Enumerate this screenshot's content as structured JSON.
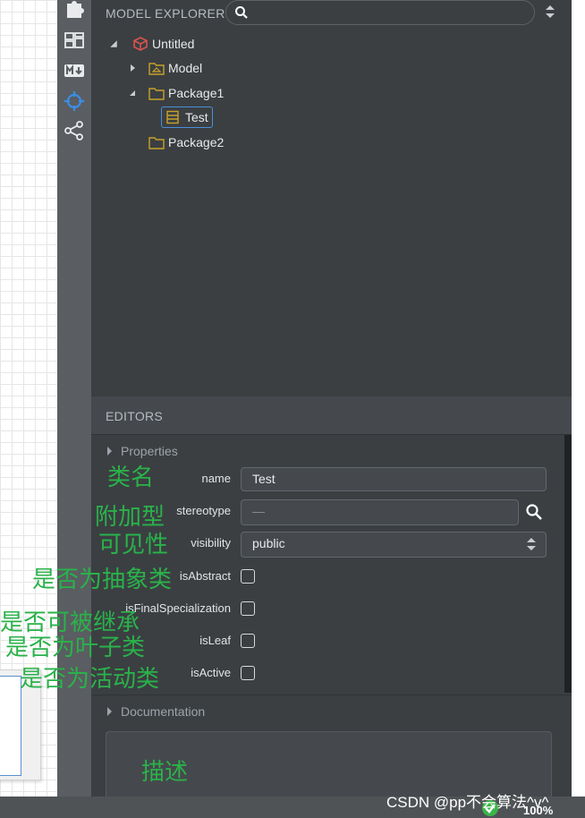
{
  "model_explorer": {
    "title": "MODEL EXPLORER",
    "search_placeholder": ""
  },
  "tree": [
    {
      "label": "Untitled",
      "type": "project",
      "expanded": true,
      "level": 0
    },
    {
      "label": "Model",
      "type": "model",
      "expanded": false,
      "level": 1
    },
    {
      "label": "Package1",
      "type": "package",
      "expanded": true,
      "level": 1
    },
    {
      "label": "Test",
      "type": "class",
      "selected": true,
      "level": 2
    },
    {
      "label": "Package2",
      "type": "package",
      "level": 1
    }
  ],
  "editors": {
    "title": "EDITORS",
    "properties_label": "Properties",
    "documentation_label": "Documentation",
    "fields": {
      "name_label": "name",
      "name_value": "Test",
      "stereotype_label": "stereotype",
      "stereotype_placeholder": "—",
      "visibility_label": "visibility",
      "visibility_value": "public",
      "isAbstract_label": "isAbstract",
      "isAbstract_checked": false,
      "isFinalSpecialization_label": "isFinalSpecialization",
      "isFinalSpecialization_checked": false,
      "isLeaf_label": "isLeaf",
      "isLeaf_checked": false,
      "isActive_label": "isActive",
      "isActive_checked": false
    }
  },
  "annotations": {
    "class_name": "类名",
    "stereotype": "附加型",
    "visibility": "可见性",
    "abstract": "是否为抽象类",
    "final": "是否可被继承",
    "leaf": "是否为叶子类",
    "active": "是否为活动类",
    "description": "描述"
  },
  "status": {
    "zoom": "100%",
    "watermark": "CSDN @pp不会算法^v^"
  },
  "colors": {
    "panel_bg": "#3b3f42",
    "accent_blue": "#4a90d9",
    "annotation_green": "#2ab24a",
    "folder_yellow": "#c8a22a",
    "project_red": "#d9534f"
  }
}
